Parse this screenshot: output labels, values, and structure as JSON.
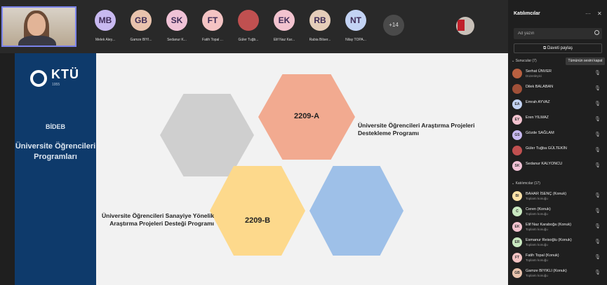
{
  "top_participants": [
    {
      "initials": "MB",
      "name": "Melek Aley...",
      "color": "#c8b9f0"
    },
    {
      "initials": "GB",
      "name": "Gamze BIYI...",
      "color": "#e9c3ad"
    },
    {
      "initials": "SK",
      "name": "Sedanur K...",
      "color": "#f0c2d6"
    },
    {
      "initials": "FT",
      "name": "Fatih Topal ...",
      "color": "#f4c3c3"
    },
    {
      "initials": "",
      "name": "Güler Tuğb...",
      "color": "#c05050"
    },
    {
      "initials": "EK",
      "name": "Elif Naz Kar...",
      "color": "#f2c3cf"
    },
    {
      "initials": "RB",
      "name": "Rabia Bilser...",
      "color": "#e5cdb9"
    },
    {
      "initials": "NT",
      "name": "Nilay TOPA...",
      "color": "#c3d3f4"
    }
  ],
  "more_count": "+14",
  "slide": {
    "logo_text": "KTÜ",
    "logo_sub": "1955",
    "bideb": "BİDEB",
    "programs_title": "Üniversite Öğrencileri Programları",
    "hex_a_label": "2209-A",
    "hex_b_label": "2209-B",
    "caption_a": "Üniversite Öğrencileri Araştırma Projeleri Destekleme Programı",
    "caption_b": "Üniversite Öğrencileri Sanayiye Yönelik Araştırma Projeleri Desteği Programı",
    "colors": {
      "panel": "#0e3a6b",
      "hex_gray": "#cfcfcf",
      "hex_orange": "#f2aa90",
      "hex_yellow": "#fdd98c",
      "hex_blue": "#9ec0e8"
    }
  },
  "panel": {
    "title": "Katılımcılar",
    "search_placeholder": "Ad yazın",
    "share_label": "Daveti paylaş",
    "presenters_header": "Sunucular (7)",
    "mute_all": "Tümünün sesini kapat",
    "presenters": [
      {
        "initials": "",
        "name": "Serhat ÜNVER",
        "role": "Düzenleyici",
        "color": "#b86040"
      },
      {
        "initials": "",
        "name": "Dilek BALABAN",
        "role": "",
        "color": "#a05038"
      },
      {
        "initials": "EA",
        "name": "Emrah AYVAZ",
        "role": "",
        "color": "#c3d3f4"
      },
      {
        "initials": "EY",
        "name": "Eren YILMAZ",
        "role": "",
        "color": "#f2c3cf"
      },
      {
        "initials": "GS",
        "name": "Gözde SAĞLAM",
        "role": "",
        "color": "#c8b9f0"
      },
      {
        "initials": "",
        "name": "Güler Tuğba GÜLTEKİN",
        "role": "",
        "color": "#c05050"
      },
      {
        "initials": "SK",
        "name": "Sedanur KALYONCU",
        "role": "",
        "color": "#f0c2d6"
      }
    ],
    "attendees_header": "Katılımcılar (17)",
    "attendees": [
      {
        "initials": "BI",
        "name": "BAHAR İSENÇ (Konuk)",
        "role": "Toplantı konuğu",
        "color": "#fde2a8"
      },
      {
        "initials": "C",
        "name": "Ceren (Konuk)",
        "role": "Toplantı konuğu",
        "color": "#c9e8c0"
      },
      {
        "initials": "EK",
        "name": "Elif Naz Karaboğa (Konuk)",
        "role": "Toplantı konuğu",
        "color": "#f2c3cf"
      },
      {
        "initials": "ER",
        "name": "Esmanur Reisoğlu (Konuk)",
        "role": "Toplantı konuğu",
        "color": "#c9e8c0"
      },
      {
        "initials": "FT",
        "name": "Fatih Topal (Konuk)",
        "role": "Toplantı konuğu",
        "color": "#f4c3c3"
      },
      {
        "initials": "GB",
        "name": "Gamze BIYIKLI (Konuk)",
        "role": "Toplantı konuğu",
        "color": "#e9c3ad"
      }
    ]
  }
}
